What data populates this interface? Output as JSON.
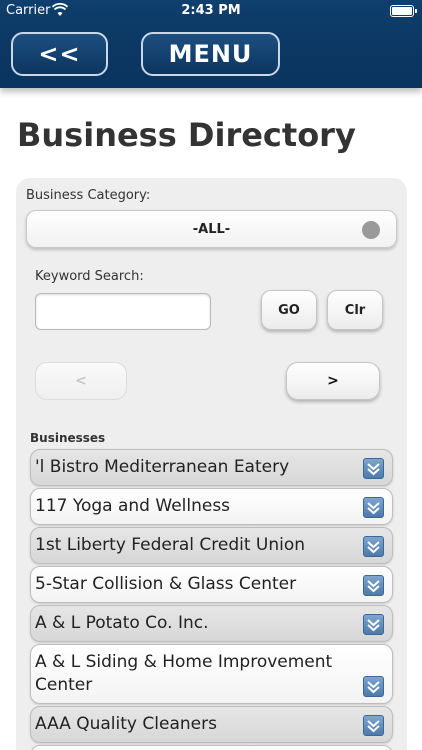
{
  "status_bar": {
    "carrier": "Carrier",
    "time": "2:43 PM"
  },
  "header": {
    "back_label": "<<",
    "menu_label": "MENU"
  },
  "page": {
    "title": "Business Directory"
  },
  "filter": {
    "category_label": "Business Category:",
    "category_value": "-ALL-",
    "keyword_label": "Keyword Search:",
    "keyword_value": "",
    "go_label": "GO",
    "clear_label": "Clr",
    "prev_label": "<",
    "next_label": ">"
  },
  "businesses": {
    "label": "Businesses",
    "items": [
      {
        "name": "'l Bistro Mediterranean Eatery"
      },
      {
        "name": "117 Yoga and Wellness"
      },
      {
        "name": "1st Liberty Federal Credit Union"
      },
      {
        "name": "5-Star Collision & Glass Center"
      },
      {
        "name": "A & L Potato Co. Inc."
      },
      {
        "name": "A & L Siding & Home Improvement Center"
      },
      {
        "name": "AAA Quality Cleaners"
      }
    ]
  },
  "colors": {
    "header_bg": "#0b3762",
    "panel_bg": "#eeeeee",
    "chevron": "#5b87b6"
  }
}
